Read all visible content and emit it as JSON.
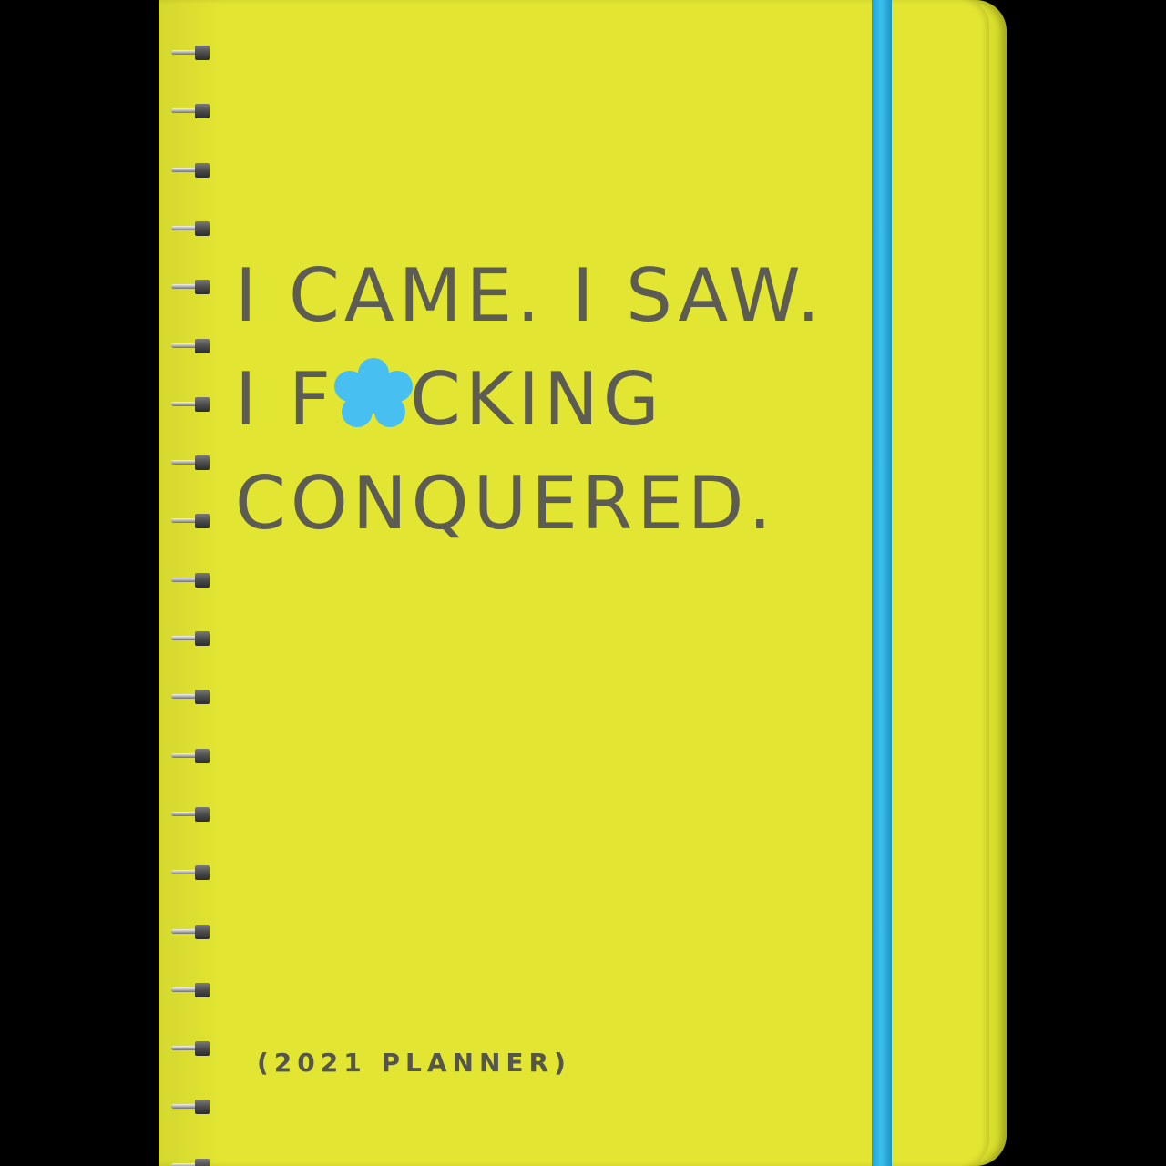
{
  "cover": {
    "background_color": "#e2e531",
    "band_color": "#3cc0ee",
    "text_color": "#5c5c52",
    "headline": {
      "line1": "I CAME. I SAW.",
      "line2_prefix": "I F",
      "line2_suffix": "CKING",
      "line3": "CONQUERED."
    },
    "censor_icon": "flower-censor-icon",
    "footer": "(2021 PLANNER)"
  }
}
